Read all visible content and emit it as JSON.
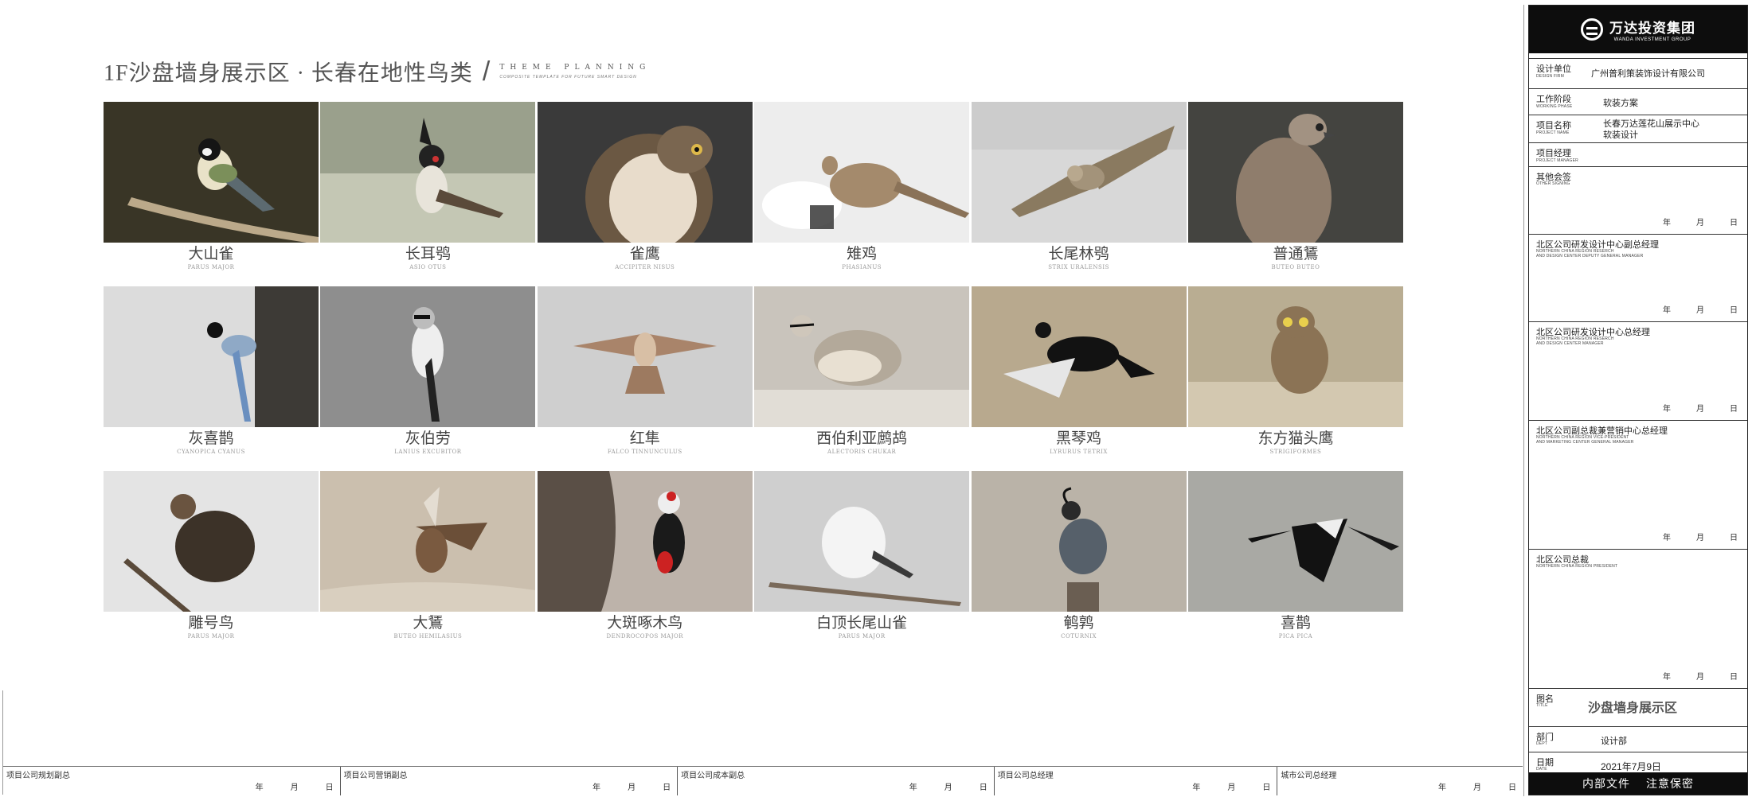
{
  "heading": {
    "title": "1F沙盘墙身展示区 · 长春在地性鸟类",
    "slash": "/",
    "theme": "THEME PLANNING",
    "theme_sub": "COMPOSITE TEMPLATE FOR FUTURE SMART DESIGN"
  },
  "birds": [
    {
      "cn": "大山雀",
      "latin": "PARUS MAJOR"
    },
    {
      "cn": "长耳鸮",
      "latin": "ASIO OTUS"
    },
    {
      "cn": "雀鹰",
      "latin": "ACCIPITER NISUS"
    },
    {
      "cn": "雉鸡",
      "latin": "PHASIANUS"
    },
    {
      "cn": "长尾林鸮",
      "latin": "STRIX URALENSIS"
    },
    {
      "cn": "普通鵟",
      "latin": "BUTEO BUTEO"
    },
    {
      "cn": "灰喜鹊",
      "latin": "CYANOPICA CYANUS"
    },
    {
      "cn": "灰伯劳",
      "latin": "LANIUS EXCUBITOR"
    },
    {
      "cn": "红隼",
      "latin": "FALCO TINNUNCULUS"
    },
    {
      "cn": "西伯利亚鹧鸪",
      "latin": "ALECTORIS CHUKAR"
    },
    {
      "cn": "黑琴鸡",
      "latin": "LYRURUS TETRIX"
    },
    {
      "cn": "东方猫头鹰",
      "latin": "STRIGIFORMES"
    },
    {
      "cn": "雕号鸟",
      "latin": "PARUS MAJOR"
    },
    {
      "cn": "大鵟",
      "latin": "BUTEO HEMILASIUS"
    },
    {
      "cn": "大斑啄木鸟",
      "latin": "DENDROCOPOS MAJOR"
    },
    {
      "cn": "白顶长尾山雀",
      "latin": "PARUS MAJOR"
    },
    {
      "cn": "鹌鹑",
      "latin": "COTURNIX"
    },
    {
      "cn": "喜鹊",
      "latin": "PICA PICA"
    }
  ],
  "bottom_sign": [
    {
      "label": "项目公司规划副总"
    },
    {
      "label": "项目公司营销副总"
    },
    {
      "label": "项目公司成本副总"
    },
    {
      "label": "项目公司总经理"
    },
    {
      "label": "城市公司总经理"
    }
  ],
  "date_units": {
    "year": "年",
    "month": "月",
    "day": "日"
  },
  "title_block": {
    "company_cn": "万达投资集团",
    "company_en": "WANDA INVESTMENT GROUP",
    "design_firm": {
      "cn": "设计单位",
      "en": "DESIGN FIRM",
      "value": "广州普利策装饰设计有限公司"
    },
    "working_phase": {
      "cn": "工作阶段",
      "en": "WORKING PHASE",
      "value": "软装方案"
    },
    "project_name": {
      "cn": "项目名称",
      "en": "PROJECT NAME",
      "value1": "长春万达莲花山展示中心",
      "value2": "软装设计"
    },
    "project_manager": {
      "cn": "项目经理",
      "en": "PROJECT MANAGER"
    },
    "other_signing": {
      "cn": "其他会签",
      "en": "OTHER SIGNING"
    },
    "deputy_gm": {
      "cn": "北区公司研发设计中心副总经理",
      "en1": "NORTHERN CHINA REGION RESERCH",
      "en2": "AND DESIGN CENTER DEPUTY GENERAL MANAGER"
    },
    "design_manager": {
      "cn": "北区公司研发设计中心总经理",
      "en1": "NORTHERN CHINA REGION RESERCH",
      "en2": "AND DESIGN CENTER MANAGER"
    },
    "vp": {
      "cn": "北区公司副总裁兼营销中心总经理",
      "en1": "NORTHERN CHINA REGION VICE-PRESIDENT",
      "en2": "AND MARKETING CENTER GENERAL MANAGER"
    },
    "president": {
      "cn": "北区公司总裁",
      "en": "NORTHERN CHINA REGION PRESIDENT"
    },
    "title": {
      "cn": "图名",
      "en": "TITLE",
      "value": "沙盘墙身展示区"
    },
    "dept": {
      "cn": "部门",
      "en": "DEPT",
      "value": "设计部"
    },
    "date": {
      "cn": "日期",
      "en": "DATE",
      "value": "2021年7月9日"
    },
    "footer_left": "内部文件",
    "footer_right": "注意保密"
  }
}
